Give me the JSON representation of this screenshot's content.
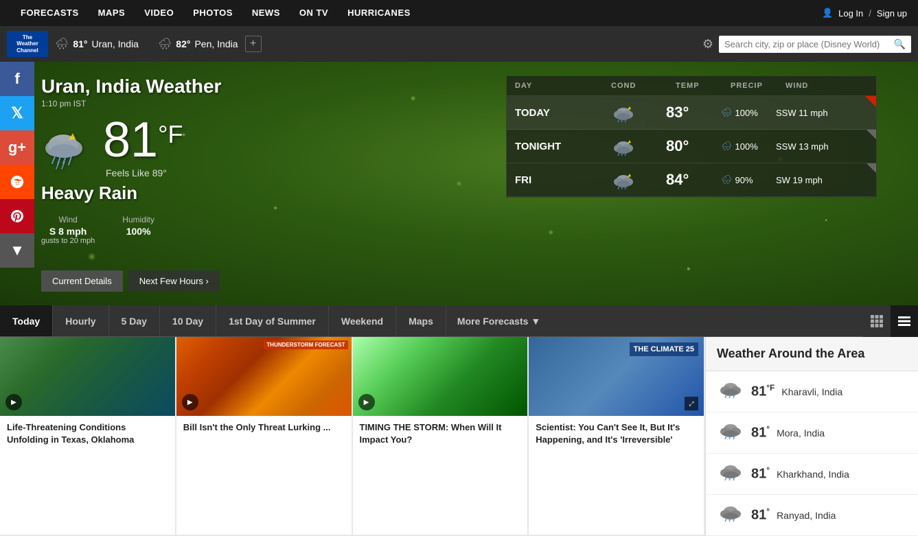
{
  "nav": {
    "links": [
      "FORECASTS",
      "MAPS",
      "VIDEO",
      "PHOTOS",
      "NEWS",
      "ON TV",
      "HURRICANES"
    ],
    "login": "Log In",
    "divider": "/",
    "signup": "Sign up"
  },
  "location_bar": {
    "logo_line1": "The",
    "logo_line2": "Weather",
    "logo_line3": "Channel",
    "location1_temp": "81°",
    "location1_name": "Uran, India",
    "location2_temp": "82°",
    "location2_name": "Pen, India",
    "search_placeholder": "Search city, zip or place (Disney World)"
  },
  "hero": {
    "city": "Uran, India Weather",
    "time": "1:10 pm IST",
    "temperature": "81",
    "unit": "°F",
    "feels_like": "Feels Like 89°",
    "condition": "Heavy Rain",
    "wind_label": "Wind",
    "wind_value": "S 8 mph",
    "wind_gusts": "gusts to 20 mph",
    "humidity_label": "Humidity",
    "humidity_value": "100%"
  },
  "buttons": {
    "current_details": "Current Details",
    "next_few_hours": "Next Few Hours ›"
  },
  "forecast": {
    "headers": [
      "DAY",
      "COND",
      "TEMP",
      "PRECIP",
      "WIND"
    ],
    "rows": [
      {
        "day": "TODAY",
        "temp": "83°",
        "precip": "100%",
        "wind": "SSW 11 mph",
        "highlight": "red"
      },
      {
        "day": "TONIGHT",
        "temp": "80°",
        "precip": "100%",
        "wind": "SSW 13 mph",
        "highlight": "grey"
      },
      {
        "day": "FRI",
        "temp": "84°",
        "precip": "90%",
        "wind": "SW 19 mph",
        "highlight": "grey"
      }
    ]
  },
  "tabs": {
    "items": [
      "Today",
      "Hourly",
      "5 Day",
      "10 Day",
      "1st Day of Summer",
      "Weekend",
      "Maps"
    ],
    "more_label": "More Forecasts",
    "active": "Today"
  },
  "social": {
    "buttons": [
      "f",
      "t",
      "g+",
      "in",
      "p",
      "▼"
    ]
  },
  "news": [
    {
      "title": "Life-Threatening Conditions Unfolding in Texas, Oklahoma",
      "has_play": true,
      "img_type": "map1"
    },
    {
      "title": "Bill Isn't the Only Threat Lurking ...",
      "has_play": true,
      "img_type": "map2",
      "badge": "THUNDERSTORM FORECAST"
    },
    {
      "title": "TIMING THE STORM: When Will It Impact You?",
      "has_play": true,
      "img_type": "map3"
    },
    {
      "title": "Scientist: You Can't See It, But It's Happening, and It's 'Irreversible'",
      "has_play": false,
      "img_type": "map4",
      "has_expand": true,
      "climate_badge": "THE CLIMATE 25"
    }
  ],
  "area": {
    "title": "Weather Around the Area",
    "items": [
      {
        "temp": "81",
        "sup": "°F",
        "name": "Kharavli, India"
      },
      {
        "temp": "81",
        "sup": "°",
        "name": "Mora, India"
      },
      {
        "temp": "81",
        "sup": "°",
        "name": "Kharkhand, India"
      },
      {
        "temp": "81",
        "sup": "°",
        "name": "Ranyad, India"
      }
    ]
  }
}
